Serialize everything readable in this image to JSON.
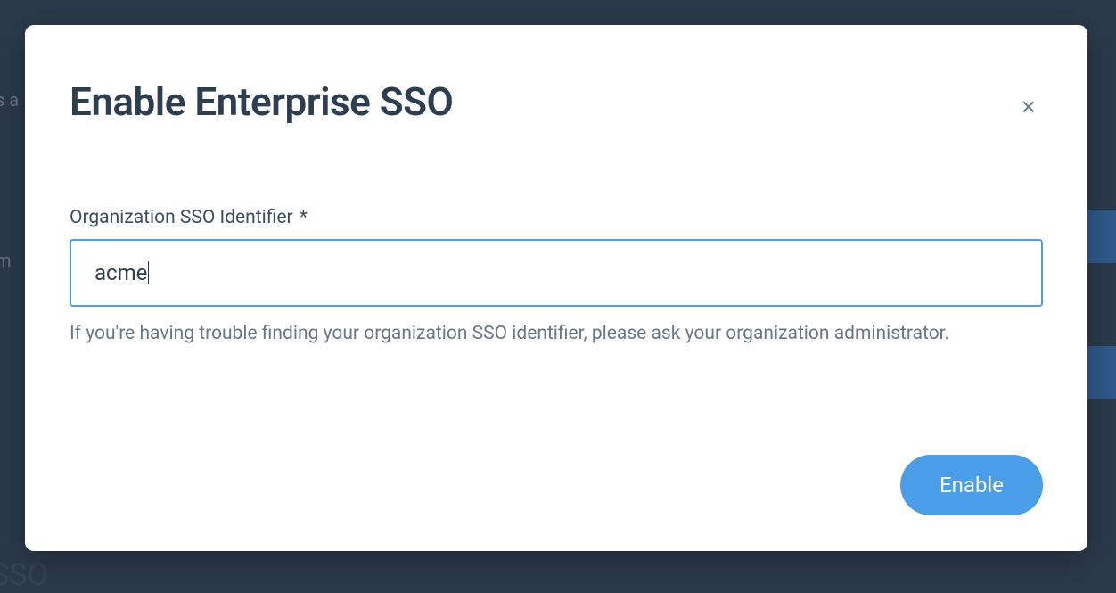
{
  "modal": {
    "title": "Enable Enterprise SSO",
    "close_label": "×",
    "form": {
      "identifier_label": "Organization SSO Identifier",
      "required_mark": "*",
      "identifier_value": "acme",
      "help_text": "If you're having trouble finding your organization SSO identifier, please ask your organization administrator."
    },
    "enable_button": "Enable"
  },
  "background": {
    "text_fragment_1": "s a",
    "text_fragment_2": "m",
    "text_fragment_3": "SSO"
  }
}
